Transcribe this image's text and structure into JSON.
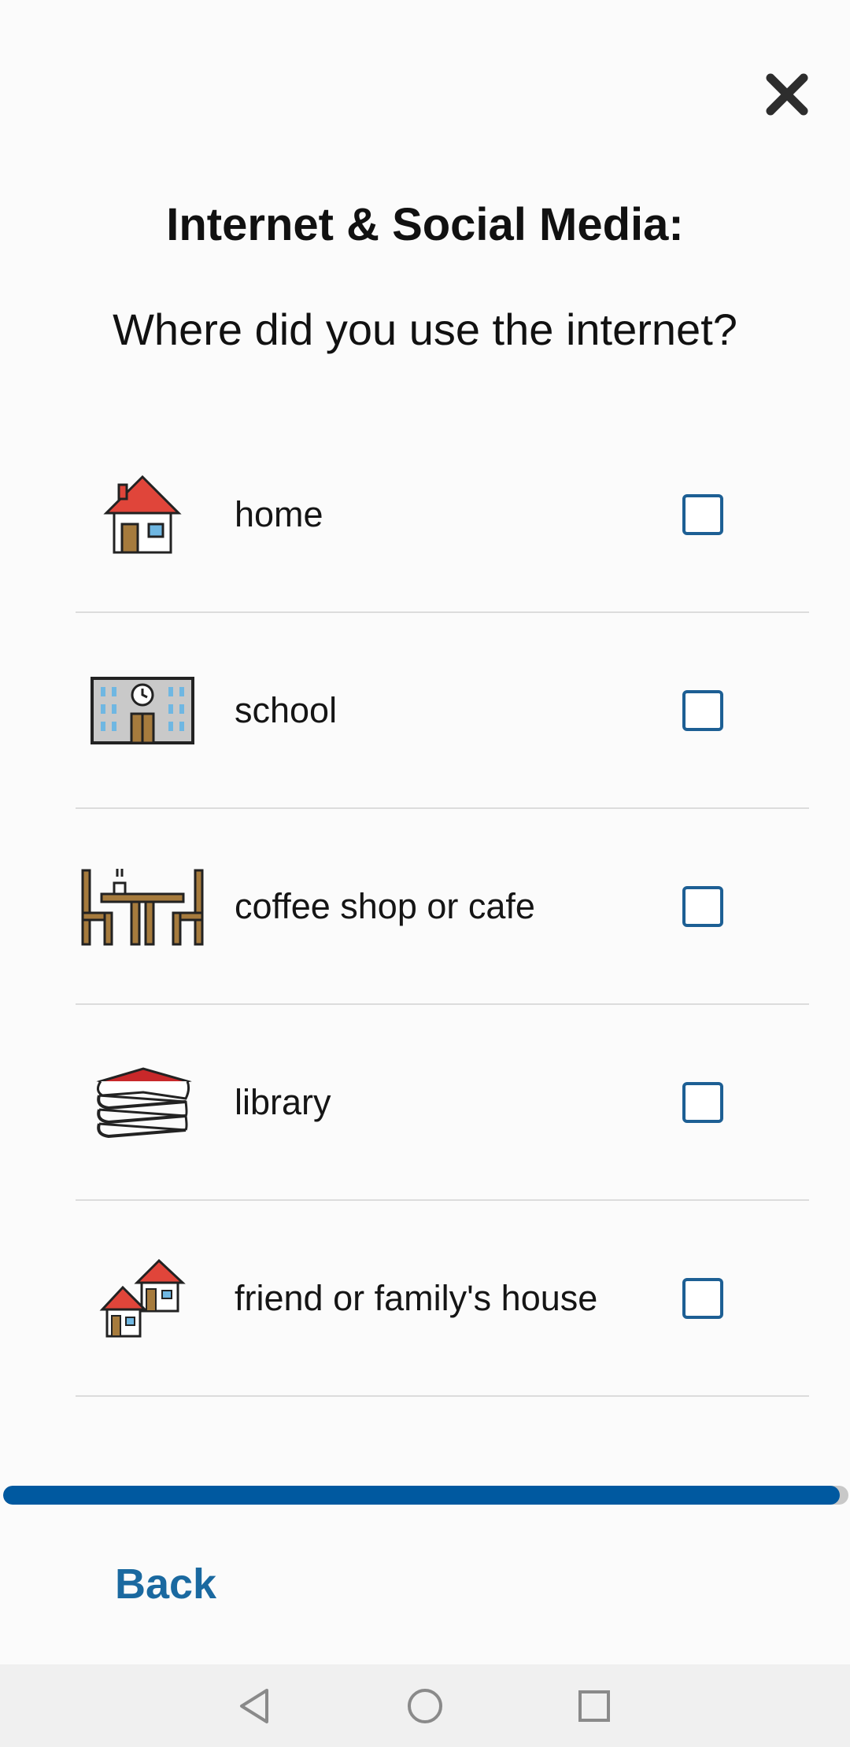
{
  "header": {
    "close_icon": "close-icon",
    "title": "Internet & Social Media:",
    "question": "Where did you use the internet?"
  },
  "options": [
    {
      "label": "home",
      "icon": "house-icon",
      "checked": false
    },
    {
      "label": "school",
      "icon": "school-building-icon",
      "checked": false
    },
    {
      "label": "coffee shop or cafe",
      "icon": "cafe-table-icon",
      "checked": false
    },
    {
      "label": "library",
      "icon": "books-icon",
      "checked": false
    },
    {
      "label": "friend or family's house",
      "icon": "houses-icon",
      "checked": false
    }
  ],
  "progress": {
    "value": 0.99
  },
  "footer": {
    "back_label": "Back"
  },
  "navbar": {
    "icons": [
      "back-triangle-icon",
      "home-circle-icon",
      "recents-square-icon"
    ]
  },
  "colors": {
    "accent": "#0059a0",
    "checkbox_border": "#1d5f94",
    "back_text": "#1a69a0",
    "roof_red": "#e0453a"
  }
}
